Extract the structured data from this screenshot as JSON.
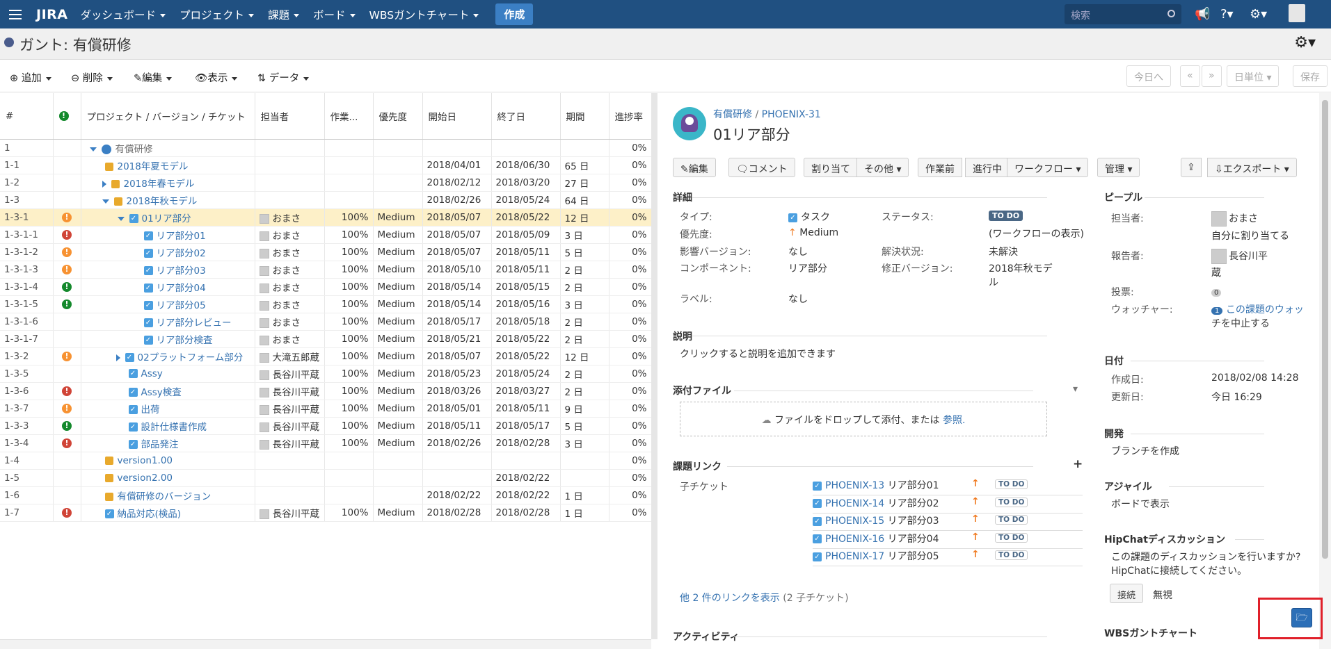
{
  "topnav": {
    "logo": "JIRA",
    "menus": [
      "ダッシュボード",
      "プロジェクト",
      "課題",
      "ボード",
      "WBSガントチャート"
    ],
    "create": "作成",
    "search_placeholder": "検索"
  },
  "header": {
    "title": "ガント: 有償研修"
  },
  "toolbar": {
    "add": "追加",
    "delete": "削除",
    "edit": "編集",
    "view": "表示",
    "data": "データ",
    "today": "今日へ",
    "prev": "«",
    "next": "»",
    "unit": "日単位",
    "save": "保存"
  },
  "grid": {
    "headers": {
      "num": "#",
      "name": "プロジェクト / バージョン / チケット",
      "assignee": "担当者",
      "work": "作業...",
      "priority": "優先度",
      "start": "開始日",
      "end": "終了日",
      "dur": "期間",
      "progress": "進捗率"
    },
    "rows": [
      {
        "num": "1",
        "name": "有償研修",
        "assignee": "",
        "work": "",
        "priority": "",
        "start": "",
        "end": "",
        "dur": "",
        "progress": "0%"
      },
      {
        "num": "1-1",
        "name": "2018年夏モデル",
        "assignee": "",
        "work": "",
        "priority": "",
        "start": "2018/04/01",
        "end": "2018/06/30",
        "dur": "65 日",
        "progress": "0%"
      },
      {
        "num": "1-2",
        "name": "2018年春モデル",
        "assignee": "",
        "work": "",
        "priority": "",
        "start": "2018/02/12",
        "end": "2018/03/20",
        "dur": "27 日",
        "progress": "0%"
      },
      {
        "num": "1-3",
        "name": "2018年秋モデル",
        "assignee": "",
        "work": "",
        "priority": "",
        "start": "2018/02/26",
        "end": "2018/05/24",
        "dur": "64 日",
        "progress": "0%"
      },
      {
        "num": "1-3-1",
        "name": "01リア部分",
        "assignee": "おまさ",
        "work": "100%",
        "priority": "Medium",
        "start": "2018/05/07",
        "end": "2018/05/22",
        "dur": "12 日",
        "progress": "0%"
      },
      {
        "num": "1-3-1-1",
        "name": "リア部分01",
        "assignee": "おまさ",
        "work": "100%",
        "priority": "Medium",
        "start": "2018/05/07",
        "end": "2018/05/09",
        "dur": "3 日",
        "progress": "0%"
      },
      {
        "num": "1-3-1-2",
        "name": "リア部分02",
        "assignee": "おまさ",
        "work": "100%",
        "priority": "Medium",
        "start": "2018/05/07",
        "end": "2018/05/11",
        "dur": "5 日",
        "progress": "0%"
      },
      {
        "num": "1-3-1-3",
        "name": "リア部分03",
        "assignee": "おまさ",
        "work": "100%",
        "priority": "Medium",
        "start": "2018/05/10",
        "end": "2018/05/11",
        "dur": "2 日",
        "progress": "0%"
      },
      {
        "num": "1-3-1-4",
        "name": "リア部分04",
        "assignee": "おまさ",
        "work": "100%",
        "priority": "Medium",
        "start": "2018/05/14",
        "end": "2018/05/15",
        "dur": "2 日",
        "progress": "0%"
      },
      {
        "num": "1-3-1-5",
        "name": "リア部分05",
        "assignee": "おまさ",
        "work": "100%",
        "priority": "Medium",
        "start": "2018/05/14",
        "end": "2018/05/16",
        "dur": "3 日",
        "progress": "0%"
      },
      {
        "num": "1-3-1-6",
        "name": "リア部分レビュー",
        "assignee": "おまさ",
        "work": "100%",
        "priority": "Medium",
        "start": "2018/05/17",
        "end": "2018/05/18",
        "dur": "2 日",
        "progress": "0%"
      },
      {
        "num": "1-3-1-7",
        "name": "リア部分検査",
        "assignee": "おまさ",
        "work": "100%",
        "priority": "Medium",
        "start": "2018/05/21",
        "end": "2018/05/22",
        "dur": "2 日",
        "progress": "0%"
      },
      {
        "num": "1-3-2",
        "name": "02プラットフォーム部分",
        "assignee": "大滝五郎蔵",
        "work": "100%",
        "priority": "Medium",
        "start": "2018/05/07",
        "end": "2018/05/22",
        "dur": "12 日",
        "progress": "0%"
      },
      {
        "num": "1-3-5",
        "name": "Assy",
        "assignee": "長谷川平蔵",
        "work": "100%",
        "priority": "Medium",
        "start": "2018/05/23",
        "end": "2018/05/24",
        "dur": "2 日",
        "progress": "0%"
      },
      {
        "num": "1-3-6",
        "name": "Assy検査",
        "assignee": "長谷川平蔵",
        "work": "100%",
        "priority": "Medium",
        "start": "2018/03/26",
        "end": "2018/03/27",
        "dur": "2 日",
        "progress": "0%"
      },
      {
        "num": "1-3-7",
        "name": "出荷",
        "assignee": "長谷川平蔵",
        "work": "100%",
        "priority": "Medium",
        "start": "2018/05/01",
        "end": "2018/05/11",
        "dur": "9 日",
        "progress": "0%"
      },
      {
        "num": "1-3-3",
        "name": "設計仕様書作成",
        "assignee": "長谷川平蔵",
        "work": "100%",
        "priority": "Medium",
        "start": "2018/05/11",
        "end": "2018/05/17",
        "dur": "5 日",
        "progress": "0%"
      },
      {
        "num": "1-3-4",
        "name": "部品発注",
        "assignee": "長谷川平蔵",
        "work": "100%",
        "priority": "Medium",
        "start": "2018/02/26",
        "end": "2018/02/28",
        "dur": "3 日",
        "progress": "0%"
      },
      {
        "num": "1-4",
        "name": "version1.00",
        "assignee": "",
        "work": "",
        "priority": "",
        "start": "",
        "end": "",
        "dur": "",
        "progress": "0%"
      },
      {
        "num": "1-5",
        "name": "version2.00",
        "assignee": "",
        "work": "",
        "priority": "",
        "start": "",
        "end": "2018/02/22",
        "dur": "",
        "progress": "0%"
      },
      {
        "num": "1-6",
        "name": "有償研修のバージョン",
        "assignee": "",
        "work": "",
        "priority": "",
        "start": "2018/02/22",
        "end": "2018/02/22",
        "dur": "1 日",
        "progress": "0%"
      },
      {
        "num": "1-7",
        "name": "納品対応(検品)",
        "assignee": "長谷川平蔵",
        "work": "100%",
        "priority": "Medium",
        "start": "2018/02/28",
        "end": "2018/02/28",
        "dur": "1 日",
        "progress": "0%"
      }
    ]
  },
  "detail": {
    "breadcrumb_project": "有償研修",
    "breadcrumb_key": "PHOENIX-31",
    "title": "01リア部分",
    "buttons": {
      "edit": "編集",
      "comment": "コメント",
      "assign": "割り当て",
      "more": "その他",
      "todo": "作業前",
      "inprogress": "進行中",
      "workflow": "ワークフロー",
      "admin": "管理",
      "export": "エクスポート"
    },
    "details_title": "詳細",
    "type_label": "タイプ:",
    "type_value": "タスク",
    "status_label": "ステータス:",
    "status_value": "TO DO",
    "workflow_link": "(ワークフローの表示)",
    "priority_label": "優先度:",
    "priority_value": "Medium",
    "affects_label": "影響バージョン:",
    "affects_value": "なし",
    "resolution_label": "解決状況:",
    "resolution_value": "未解決",
    "component_label": "コンポーネント:",
    "component_value": "リア部分",
    "fixver_label": "修正バージョン:",
    "fixver_value_1": "2018年秋モデ",
    "fixver_value_2": "ル",
    "labels_label": "ラベル:",
    "labels_value": "なし",
    "desc_title": "説明",
    "desc_text": "クリックすると説明を追加できます",
    "attach_title": "添付ファイル",
    "attach_text": "ファイルをドロップして添付、または",
    "attach_browse": "参照.",
    "links_title": "課題リンク",
    "subtasks_label": "子チケット",
    "links": [
      {
        "key": "PHOENIX-13",
        "name": "リア部分01",
        "status": "TO DO"
      },
      {
        "key": "PHOENIX-14",
        "name": "リア部分02",
        "status": "TO DO"
      },
      {
        "key": "PHOENIX-15",
        "name": "リア部分03",
        "status": "TO DO"
      },
      {
        "key": "PHOENIX-16",
        "name": "リア部分04",
        "status": "TO DO"
      },
      {
        "key": "PHOENIX-17",
        "name": "リア部分05",
        "status": "TO DO"
      }
    ],
    "more_links": "他 2 件のリンクを表示",
    "more_links_count": "(2 子チケット)",
    "activity_title": "アクティビティ"
  },
  "people": {
    "title": "ピープル",
    "assignee_label": "担当者:",
    "assignee_value": "おまさ",
    "assign_me": "自分に割り当てる",
    "reporter_label": "報告者:",
    "reporter_value_1": "長谷川平",
    "reporter_value_2": "蔵",
    "votes_label": "投票:",
    "votes_value": "0",
    "watchers_label": "ウォッチャー:",
    "watchers_count": "1",
    "watch_link_1": "この課題のウォッ",
    "watch_link_2": "チを中止する"
  },
  "dates": {
    "title": "日付",
    "created_label": "作成日:",
    "created_value": "2018/02/08 14:28",
    "updated_label": "更新日:",
    "updated_value": "今日 16:29"
  },
  "dev": {
    "title": "開発",
    "create_branch": "ブランチを作成"
  },
  "agile": {
    "title": "アジャイル",
    "view_board": "ボードで表示"
  },
  "hipchat": {
    "title": "HipChatディスカッション",
    "text_1": "この課題のディスカッションを行いますか?",
    "text_2": "HipChatに接続してください。",
    "connect": "接続",
    "ignore": "無視"
  },
  "wbs": {
    "title": "WBSガントチャート"
  }
}
